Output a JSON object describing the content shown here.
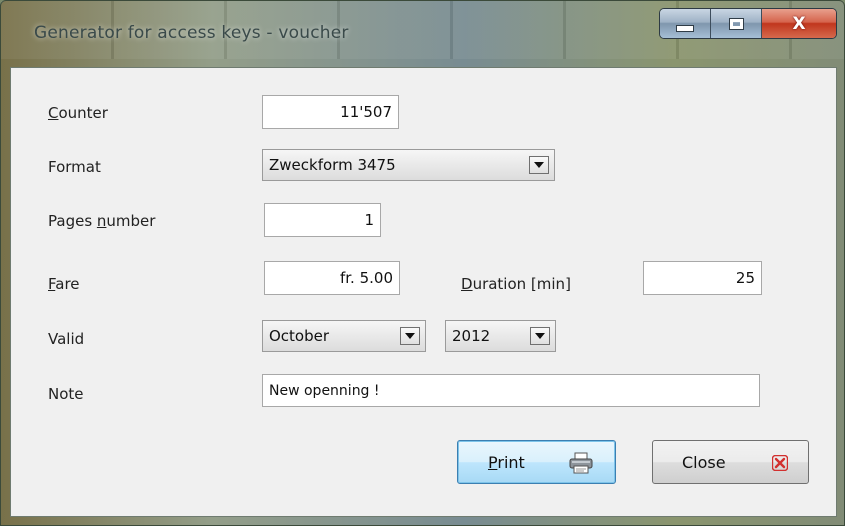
{
  "window": {
    "title": "Generator for access keys - voucher",
    "close_glyph": "X"
  },
  "form": {
    "counter": {
      "label": "Counter",
      "value": "11'507"
    },
    "format": {
      "label": "Format",
      "selected": "Zweckform 3475"
    },
    "pages_number": {
      "label": "Pages number",
      "value": "1"
    },
    "fare": {
      "label": "Fare",
      "value": "fr. 5.00"
    },
    "duration": {
      "label": "Duration [min]",
      "value": "25"
    },
    "valid": {
      "label": "Valid",
      "month": "October",
      "year": "2012"
    },
    "note": {
      "label": "Note",
      "value": "New openning !"
    }
  },
  "buttons": {
    "print": {
      "label": "Print",
      "icon": "printer-icon"
    },
    "close": {
      "label": "Close",
      "icon": "red-x-icon"
    }
  },
  "colors": {
    "default_button_border": "#3c7fb1",
    "close_icon": "#d2302f"
  }
}
